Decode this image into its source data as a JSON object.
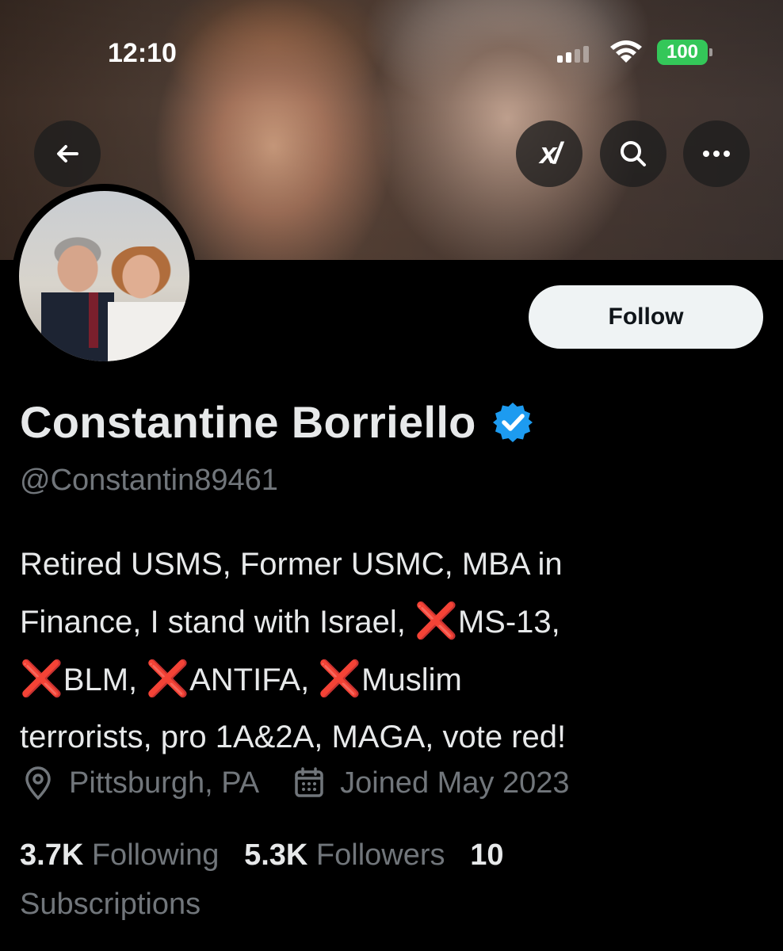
{
  "status_bar": {
    "time": "12:10",
    "battery": "100"
  },
  "header": {
    "back_icon": "back-arrow-icon",
    "grok_label": "x/",
    "search_icon": "search-icon",
    "more_icon": "more-icon"
  },
  "profile": {
    "follow_label": "Follow",
    "display_name": "Constantine Borriello",
    "handle": "@Constantin89461",
    "bio": {
      "line1": "Retired USMS, Former USMC, MBA in",
      "line2a": "Finance, I stand with Israel, ",
      "line2b": "MS-13,",
      "line3a": "BLM, ",
      "line3b": "ANTIFA, ",
      "line3c": "Muslim",
      "line4": "terrorists, pro 1A&2A, MAGA, vote red!",
      "x_mark": "❌"
    },
    "location": "Pittsburgh, PA",
    "joined": "Joined May 2023",
    "following_count": "3.7K",
    "following_label": "Following",
    "followers_count": "5.3K",
    "followers_label": "Followers",
    "subscriptions_count": "10",
    "subscriptions_label": "Subscriptions"
  },
  "colors": {
    "background": "#000000",
    "text": "#e7e9ea",
    "muted": "#71767b",
    "verified": "#1d9bf0",
    "battery": "#34c759",
    "red_x": "#e8212d"
  }
}
